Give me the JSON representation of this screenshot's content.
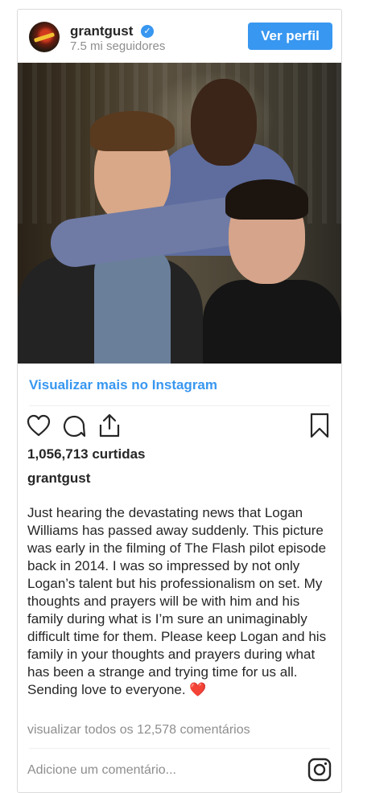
{
  "post": {
    "username": "grantgust",
    "followers": "7.5 mi seguidores",
    "view_profile_label": "Ver perfil",
    "view_more_label": "Visualizar mais no Instagram",
    "likes": "1,056,713 curtidas",
    "caption_author": "grantgust",
    "caption_text": "Just hearing the devastating news that Logan Williams has passed away suddenly. This picture was early in the filming of The Flash pilot episode back in 2014. I was so impressed by not only Logan’s talent but his professionalism on set. My thoughts and prayers will be with him and his family during what is I’m sure an unimaginably difficult time for them. Please keep Logan and his family in your thoughts and prayers during what has been a strange and trying time for us all. Sending love to everyone.",
    "caption_emoji": "❤️",
    "view_comments": "visualizar todos os 12,578 comentários",
    "comment_placeholder": "Adicione um comentário..."
  },
  "colors": {
    "accent": "#3897f0",
    "text": "#262626",
    "muted": "#8e8e8e",
    "border": "#dbdbdb"
  },
  "icons": {
    "verified": "verified-badge-icon",
    "like": "heart-icon",
    "comment": "comment-icon",
    "share": "share-icon",
    "save": "bookmark-icon",
    "instagram": "instagram-logo-icon"
  }
}
